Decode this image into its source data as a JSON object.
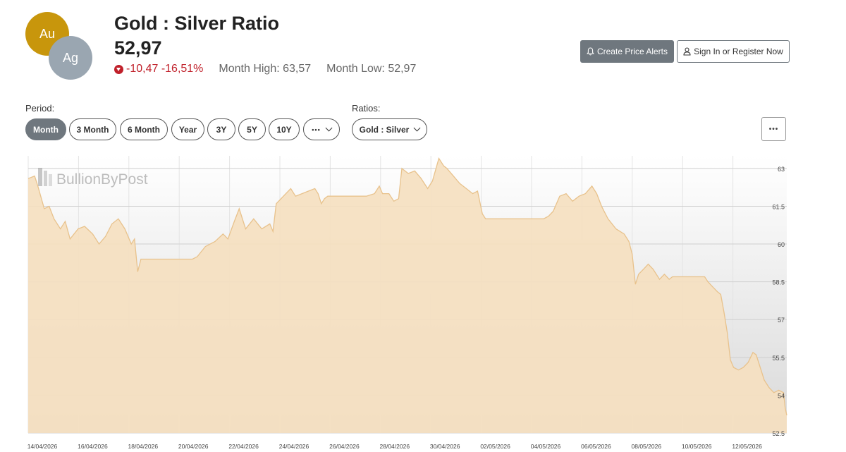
{
  "header": {
    "coin_au": "Au",
    "coin_ag": "Ag",
    "title": "Gold : Silver Ratio",
    "price": "52,97",
    "change": "-10,47 -16,51%",
    "month_high": "Month High: 63,57",
    "month_low": "Month Low: 52,97"
  },
  "actions": {
    "alerts_label": "Create Price Alerts",
    "signin_label": "Sign In or Register Now"
  },
  "controls": {
    "period_label": "Period:",
    "ratios_label": "Ratios:",
    "periods": [
      "Month",
      "3 Month",
      "6 Month",
      "Year",
      "3Y",
      "5Y",
      "10Y",
      "•••"
    ],
    "active_period": "Month",
    "ratio_selected": "Gold : Silver",
    "menu_label": "•••"
  },
  "icons": {
    "down": "down-triangle-icon",
    "bell": "bell-icon",
    "user": "user-icon",
    "chevron": "chevron-down-icon"
  },
  "colors": {
    "gold": "#c8960c",
    "silver": "#9aa6b1",
    "negative": "#c0202a",
    "line": "#e8c28c",
    "fill": "#f5dfc0"
  },
  "chart_data": {
    "type": "area",
    "watermark": "BullionByPost",
    "x_labels": [
      "14/04/2026",
      "16/04/2026",
      "18/04/2026",
      "20/04/2026",
      "22/04/2026",
      "24/04/2026",
      "26/04/2026",
      "28/04/2026",
      "30/04/2026",
      "02/05/2026",
      "04/05/2026",
      "06/05/2026",
      "08/05/2026",
      "10/05/2026",
      "12/05/2026"
    ],
    "y_ticks": [
      52.5,
      54,
      55.5,
      57,
      58.5,
      60,
      61.5,
      63
    ],
    "y_tick_labels": [
      "52.5",
      "54",
      "55.5",
      "57",
      "58.5",
      "60",
      "61.5",
      "63"
    ],
    "ylim": [
      52.5,
      63.5
    ],
    "xlim": [
      0,
      30
    ],
    "grid": true,
    "points": [
      [
        0,
        62.6
      ],
      [
        0.4,
        62.7
      ],
      [
        0.6,
        62.3
      ],
      [
        1,
        61.4
      ],
      [
        1.3,
        61.5
      ],
      [
        1.6,
        61.0
      ],
      [
        2,
        60.6
      ],
      [
        2.3,
        60.9
      ],
      [
        2.6,
        60.2
      ],
      [
        3.1,
        60.6
      ],
      [
        3.5,
        60.7
      ],
      [
        4,
        60.4
      ],
      [
        4.4,
        60.0
      ],
      [
        4.8,
        60.3
      ],
      [
        5.2,
        60.8
      ],
      [
        5.6,
        61.0
      ],
      [
        6,
        60.6
      ],
      [
        6.4,
        60.0
      ],
      [
        6.6,
        60.2
      ],
      [
        6.8,
        58.9
      ],
      [
        7,
        59.4
      ],
      [
        7.3,
        59.4
      ],
      [
        9,
        59.4
      ],
      [
        10.2,
        59.4
      ],
      [
        10.5,
        59.5
      ],
      [
        11,
        59.9
      ],
      [
        11.6,
        60.1
      ],
      [
        12.1,
        60.4
      ],
      [
        12.4,
        60.2
      ],
      [
        12.8,
        60.9
      ],
      [
        13.1,
        61.4
      ],
      [
        13.5,
        60.6
      ],
      [
        14,
        61.0
      ],
      [
        14.5,
        60.6
      ],
      [
        15,
        60.8
      ],
      [
        15.2,
        60.5
      ],
      [
        15.4,
        61.6
      ],
      [
        15.7,
        61.8
      ],
      [
        16,
        62.0
      ],
      [
        16.3,
        62.2
      ],
      [
        16.6,
        61.9
      ],
      [
        17,
        62.0
      ],
      [
        17.4,
        62.1
      ],
      [
        17.8,
        62.2
      ],
      [
        18,
        62.0
      ],
      [
        18.2,
        61.6
      ],
      [
        18.4,
        61.8
      ],
      [
        18.6,
        61.9
      ],
      [
        20,
        61.9
      ],
      [
        21,
        61.9
      ],
      [
        21.5,
        62.0
      ],
      [
        21.8,
        62.3
      ],
      [
        22,
        62.0
      ],
      [
        22.4,
        62.0
      ],
      [
        22.7,
        61.7
      ],
      [
        23,
        61.8
      ],
      [
        23.2,
        63.0
      ],
      [
        23.6,
        62.8
      ],
      [
        24,
        62.9
      ],
      [
        24.4,
        62.6
      ],
      [
        24.8,
        62.2
      ],
      [
        25.1,
        62.5
      ],
      [
        25.5,
        63.4
      ],
      [
        25.8,
        63.1
      ],
      [
        26,
        63.0
      ],
      [
        26.4,
        62.7
      ],
      [
        26.8,
        62.4
      ],
      [
        27.2,
        62.2
      ],
      [
        27.6,
        62.0
      ],
      [
        27.9,
        62.1
      ],
      [
        28.2,
        61.2
      ],
      [
        28.4,
        61.0
      ],
      [
        28.6,
        61.0
      ],
      [
        29,
        61.0
      ],
      [
        30,
        61.0
      ],
      [
        31,
        61.0
      ],
      [
        32,
        61.0
      ],
      [
        32.3,
        61.1
      ],
      [
        32.6,
        61.3
      ],
      [
        33,
        61.9
      ],
      [
        33.4,
        62.0
      ],
      [
        33.8,
        61.7
      ],
      [
        34.2,
        61.9
      ],
      [
        34.6,
        62.0
      ],
      [
        35,
        62.3
      ],
      [
        35.3,
        62.0
      ],
      [
        35.6,
        61.5
      ],
      [
        36,
        61.0
      ],
      [
        36.5,
        60.6
      ],
      [
        37,
        60.4
      ],
      [
        37.3,
        60.1
      ],
      [
        37.5,
        59.6
      ],
      [
        37.7,
        58.4
      ],
      [
        37.9,
        58.8
      ],
      [
        38.2,
        59.0
      ],
      [
        38.5,
        59.2
      ],
      [
        38.8,
        59.0
      ],
      [
        39.2,
        58.6
      ],
      [
        39.5,
        58.8
      ],
      [
        39.8,
        58.6
      ],
      [
        40,
        58.7
      ],
      [
        41,
        58.7
      ],
      [
        42,
        58.7
      ],
      [
        42.2,
        58.5
      ],
      [
        42.5,
        58.3
      ],
      [
        42.8,
        58.1
      ],
      [
        43,
        58.0
      ],
      [
        43.2,
        57.3
      ],
      [
        43.4,
        56.5
      ],
      [
        43.6,
        55.4
      ],
      [
        43.8,
        55.1
      ],
      [
        44.1,
        55.0
      ],
      [
        44.4,
        55.1
      ],
      [
        44.7,
        55.3
      ],
      [
        45,
        55.7
      ],
      [
        45.2,
        55.6
      ],
      [
        45.4,
        55.2
      ],
      [
        45.7,
        54.6
      ],
      [
        46,
        54.3
      ],
      [
        46.3,
        54.1
      ],
      [
        46.6,
        54.2
      ],
      [
        46.9,
        54.1
      ],
      [
        47,
        53.5
      ],
      [
        47.1,
        53.2
      ]
    ],
    "x_point_scale_note": "points x in half-day units from 14/04/2026"
  }
}
